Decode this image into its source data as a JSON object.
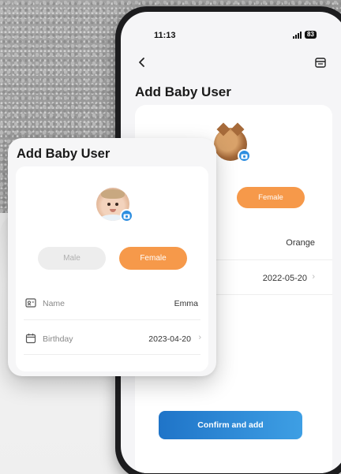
{
  "status_bar": {
    "time": "11:13",
    "battery": "83"
  },
  "phone": {
    "title": "Add Baby User",
    "female_label": "Female",
    "name_value": "Orange",
    "birthday_value": "2022-05-20",
    "chevron": "›",
    "confirm_label": "Confirm and add"
  },
  "card": {
    "title": "Add Baby User",
    "male_label": "Male",
    "female_label": "Female",
    "selected_gender": "Female",
    "fields": [
      {
        "label": "Name",
        "value": "Emma",
        "icon": "id-card-icon"
      },
      {
        "label": "Birthday",
        "value": "2023-04-20",
        "icon": "calendar-icon"
      }
    ],
    "chevron": "›"
  },
  "colors": {
    "accent_orange": "#f6994a",
    "confirm_blue": "#2d8ee0",
    "inactive_gray": "#ededed"
  }
}
